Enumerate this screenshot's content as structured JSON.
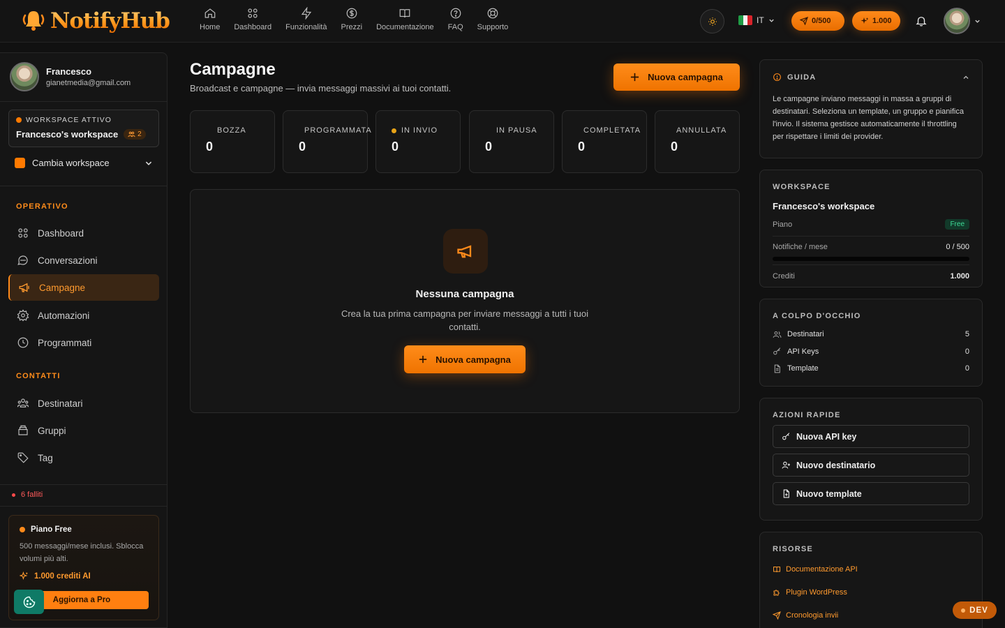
{
  "app": {
    "name": "NotifyHub",
    "nav": [
      {
        "label": "Home",
        "icon": "home-icon"
      },
      {
        "label": "Dashboard",
        "icon": "grid-icon"
      },
      {
        "label": "Funzionalità",
        "icon": "bolt-icon"
      },
      {
        "label": "Prezzi",
        "icon": "dollar-icon"
      },
      {
        "label": "Documentazione",
        "icon": "book-icon"
      },
      {
        "label": "FAQ",
        "icon": "help-icon"
      },
      {
        "label": "Supporto",
        "icon": "lifebuoy-icon"
      }
    ],
    "language": "IT",
    "notifications_pill": "0/500",
    "credits_pill": "1.000",
    "accent": "#ff8a1a"
  },
  "sidebar": {
    "user_name": "Francesco",
    "user_email": "gianetmedia@gmail.com",
    "workspace_label": "WORKSPACE ATTIVO",
    "workspace_name": "Francesco's workspace",
    "workspace_members": "2",
    "switch_label": "Cambia workspace",
    "section_operativo": "OPERATIVO",
    "section_contatti": "CONTATTI",
    "items": [
      {
        "label": "Dashboard",
        "icon": "grid-icon"
      },
      {
        "label": "Conversazioni",
        "icon": "chat-icon"
      },
      {
        "label": "Campagne",
        "icon": "megaphone-icon",
        "active": true
      },
      {
        "label": "Automazioni",
        "icon": "cog-icon"
      },
      {
        "label": "Programmati",
        "icon": "clock-icon"
      },
      {
        "label": "Destinatari",
        "icon": "users-icon"
      },
      {
        "label": "Gruppi",
        "icon": "box-icon"
      },
      {
        "label": "Tag",
        "icon": "tag-icon"
      }
    ],
    "failed": "6 falliti",
    "plan_title": "Piano Free",
    "plan_desc": "500 messaggi/mese inclusi. Sblocca volumi più alti.",
    "plan_credits": "1.000 crediti AI",
    "upgrade_label": "Aggiorna a Pro"
  },
  "main": {
    "title": "Campagne",
    "subtitle": "Broadcast e campagne — invia messaggi massivi ai tuoi contatti.",
    "new_campaign": "Nuova campagna",
    "stats": [
      {
        "label": "BOZZA",
        "value": "0"
      },
      {
        "label": "PROGRAMMATA",
        "value": "0"
      },
      {
        "label": "IN INVIO",
        "value": "0",
        "dot": "#e8a317"
      },
      {
        "label": "IN PAUSA",
        "value": "0"
      },
      {
        "label": "COMPLETATA",
        "value": "0"
      },
      {
        "label": "ANNULLATA",
        "value": "0"
      }
    ],
    "empty_title": "Nessuna campagna",
    "empty_desc": "Crea la tua prima campagna per inviare messaggi a tutti i tuoi contatti.",
    "empty_button": "Nuova campagna"
  },
  "right": {
    "guide_title": "GUIDA",
    "guide_text": "Le campagne inviano messaggi in massa a gruppi di destinatari. Seleziona un template, un gruppo e pianifica l'invio. Il sistema gestisce automaticamente il throttling per rispettare i limiti dei provider.",
    "ws_title": "WORKSPACE",
    "ws_name": "Francesco's workspace",
    "plan_label": "Piano",
    "plan_value": "Free",
    "notif_label": "Notifiche / mese",
    "notif_value": "0 / 500",
    "notif_usage": 0,
    "credits_label": "Crediti",
    "credits_value": "1.000",
    "glance_title": "A COLPO D'OCCHIO",
    "glance": [
      {
        "label": "Destinatari",
        "value": "5",
        "icon": "users-icon"
      },
      {
        "label": "API Keys",
        "value": "0",
        "icon": "key-icon"
      },
      {
        "label": "Template",
        "value": "0",
        "icon": "file-icon"
      }
    ],
    "quick_title": "AZIONI RAPIDE",
    "quick": [
      {
        "label": "Nuova API key",
        "icon": "key-icon"
      },
      {
        "label": "Nuovo destinatario",
        "icon": "user-plus-icon"
      },
      {
        "label": "Nuovo template",
        "icon": "file-plus-icon"
      }
    ],
    "res_title": "RISORSE",
    "resources": [
      {
        "label": "Documentazione API",
        "icon": "book-icon"
      },
      {
        "label": "Plugin WordPress",
        "icon": "puzzle-icon"
      },
      {
        "label": "Cronologia invii",
        "icon": "send-icon"
      }
    ]
  },
  "dev_badge": "DEV"
}
